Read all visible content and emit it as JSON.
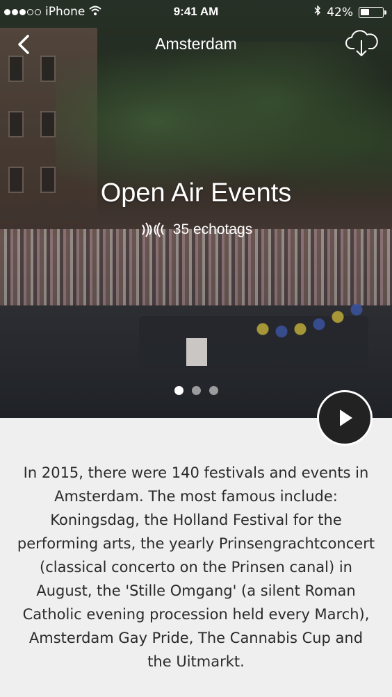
{
  "status_bar": {
    "carrier": "iPhone",
    "time": "9:41 AM",
    "battery_percent": "42%",
    "battery_level": 0.42,
    "signal_dots": [
      true,
      true,
      true,
      false,
      false
    ]
  },
  "nav": {
    "title": "Amsterdam",
    "back_icon": "chevron-left-icon",
    "download_icon": "cloud-download-icon"
  },
  "hero": {
    "title": "Open Air Events",
    "echotags_label": "35 echotags",
    "pager": {
      "count": 3,
      "active_index": 0
    }
  },
  "description": "In 2015, there were 140 festivals and events in Amsterdam. The most famous include: Koningsdag, the Holland Festival for the performing arts, the yearly Prinsengrachtconcert (classical concerto on the Prinsen canal) in August, the 'Stille Omgang' (a silent Roman Catholic evening procession held every March), Amsterdam Gay Pride, The Cannabis Cup and the Uitmarkt.",
  "colors": {
    "accent_dark": "#222222",
    "background": "#efefef",
    "text": "#2a2a2a"
  }
}
